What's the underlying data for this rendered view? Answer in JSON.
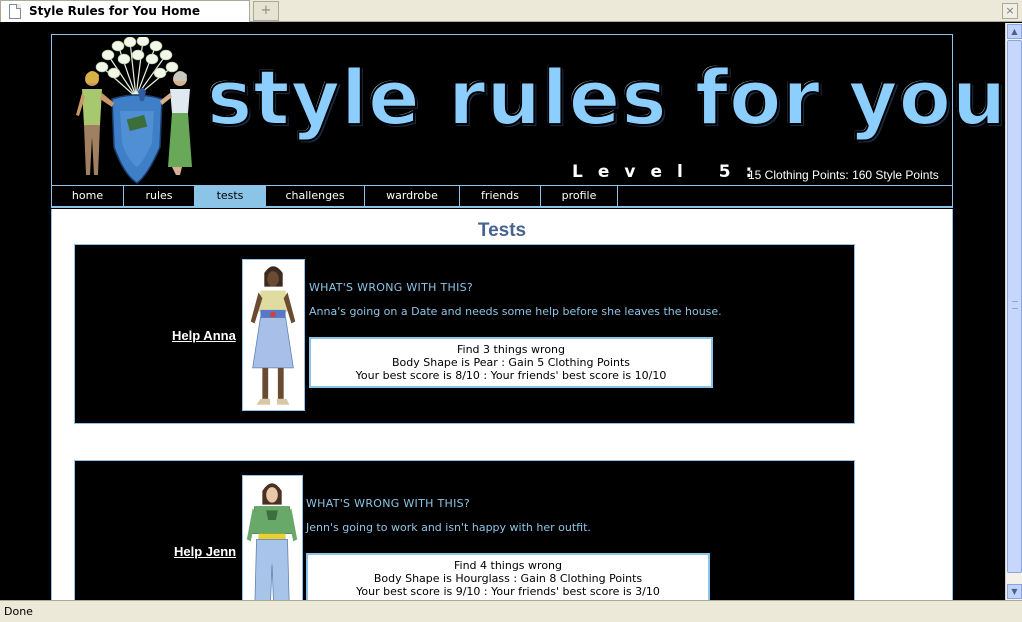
{
  "browser": {
    "tab_title": "Style Rules for You Home",
    "new_tab_symbol": "+",
    "close_symbol": "×",
    "status": "Done"
  },
  "header": {
    "brand": "style rules for you",
    "level": "Level 5:",
    "points": "15 Clothing Points: 160 Style Points"
  },
  "nav": [
    "home",
    "rules",
    "tests",
    "challenges",
    "wardrobe",
    "friends",
    "profile"
  ],
  "nav_active": "tests",
  "page_title": "Tests",
  "tests": [
    {
      "help": "Help Anna",
      "question": "WHAT'S WRONG WITH THIS?",
      "desc": "Anna's going on a Date and needs some help before she leaves the house.",
      "line1": "Find 3 things wrong",
      "line2": "Body Shape is Pear  :  Gain 5 Clothing Points",
      "line3": "Your best score is 8/10  :  Your friends' best score is 10/10"
    },
    {
      "help": "Help Jenn",
      "question": "WHAT'S WRONG WITH THIS?",
      "desc": "Jenn's going to work and isn't happy with her outfit.",
      "line1": "Find 4 things wrong",
      "line2": "Body Shape is Hourglass  :  Gain 8 Clothing Points",
      "line3": "Your best score is 9/10  :  Your friends' best score is 3/10"
    }
  ],
  "colors": {
    "accent": "#8cc4e8",
    "title": "#466392",
    "background": "#000000"
  }
}
